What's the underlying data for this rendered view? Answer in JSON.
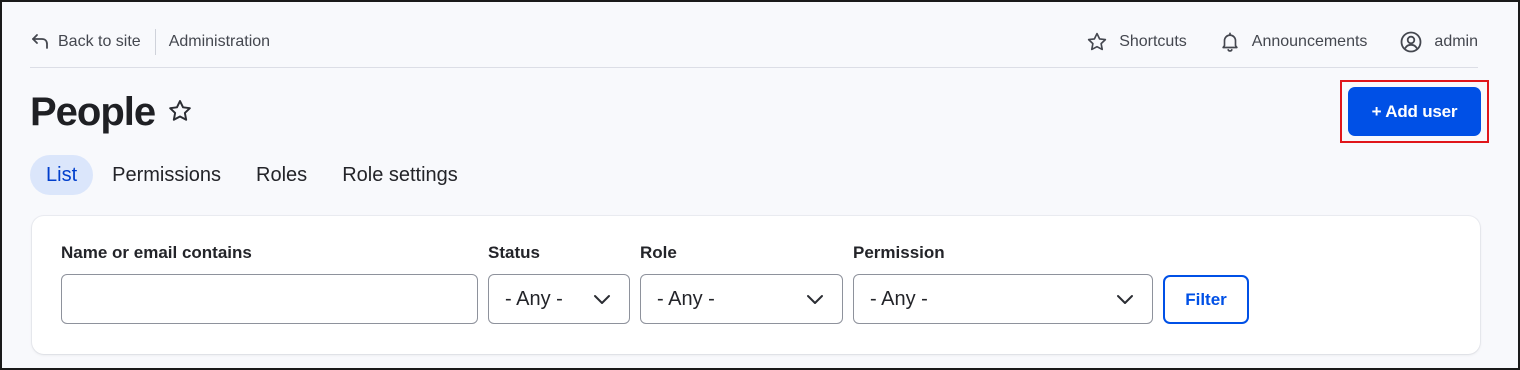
{
  "toolbar": {
    "back_label": "Back to site",
    "section_label": "Administration",
    "shortcuts_label": "Shortcuts",
    "announcements_label": "Announcements",
    "user_label": "admin"
  },
  "page": {
    "title": "People",
    "add_button_label": "+ Add user"
  },
  "tabs": [
    {
      "label": "List",
      "active": true
    },
    {
      "label": "Permissions",
      "active": false
    },
    {
      "label": "Roles",
      "active": false
    },
    {
      "label": "Role settings",
      "active": false
    }
  ],
  "filters": {
    "name": {
      "label": "Name or email contains",
      "value": ""
    },
    "status": {
      "label": "Status",
      "value": "- Any -"
    },
    "role": {
      "label": "Role",
      "value": "- Any -"
    },
    "permission": {
      "label": "Permission",
      "value": "- Any -"
    },
    "submit_label": "Filter"
  },
  "colors": {
    "accent": "#0050e6",
    "active_tab_bg": "#dbe6fb",
    "highlight_border": "#e0161b"
  },
  "icons": {
    "back": "back-arrow-icon",
    "shortcuts": "star-icon",
    "announcements": "bell-icon",
    "user": "user-circle-icon",
    "title_star": "star-icon",
    "select": "chevron-down-icon"
  }
}
